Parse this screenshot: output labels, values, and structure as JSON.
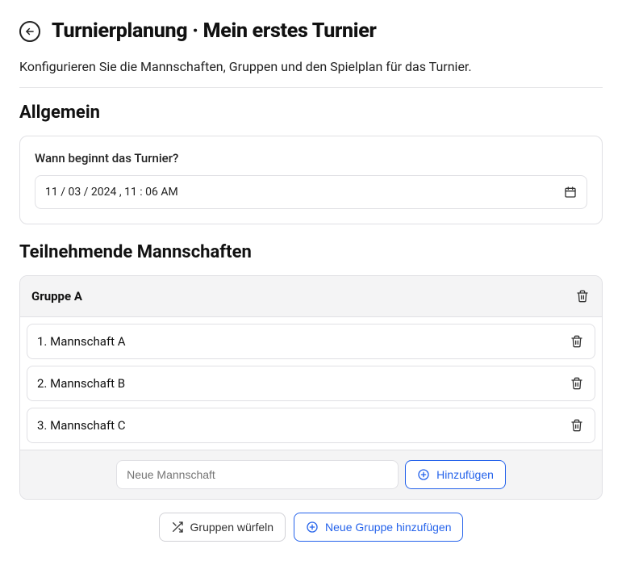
{
  "page": {
    "title": "Turnierplanung · Mein erstes Turnier",
    "description": "Konfigurieren Sie die Mannschaften, Gruppen und den Spielplan für das Turnier."
  },
  "general": {
    "heading": "Allgemein",
    "start_label": "Wann beginnt das Turnier?",
    "datetime_display": "11 / 03 / 2024 ,  11 : 06   AM"
  },
  "teams_section": {
    "heading": "Teilnehmende Mannschaften"
  },
  "groups": [
    {
      "name": "Gruppe A",
      "teams": [
        "1. Mannschaft A",
        "2. Mannschaft B",
        "3. Mannschaft C"
      ]
    }
  ],
  "new_team": {
    "placeholder": "Neue Mannschaft",
    "add_label": "Hinzufügen"
  },
  "actions": {
    "shuffle_groups": "Gruppen würfeln",
    "add_group": "Neue Gruppe hinzufügen"
  }
}
